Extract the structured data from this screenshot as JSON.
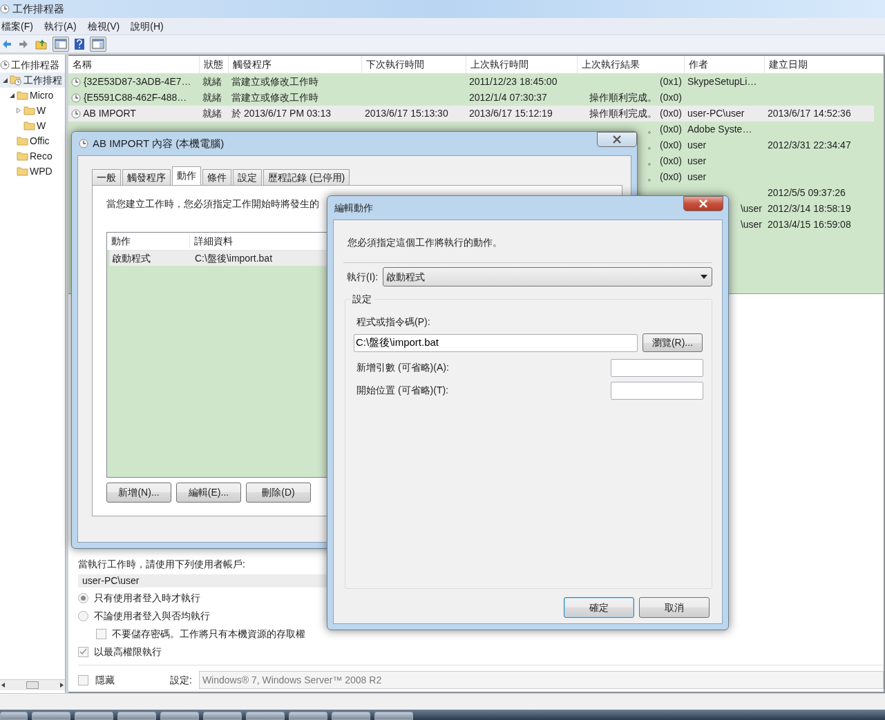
{
  "window": {
    "title": "工作排程器"
  },
  "menu": [
    "檔案(F)",
    "執行(A)",
    "檢視(V)",
    "說明(H)"
  ],
  "tree": [
    {
      "label": "工作排程器",
      "kind": "scheduler",
      "children": [
        {
          "label": "工作排程",
          "kind": "library",
          "expanded": true,
          "selected": true,
          "children": [
            {
              "label": "Micro",
              "kind": "folder",
              "expanded": true,
              "selected": false,
              "children": [
                {
                  "label": "W",
                  "kind": "folder",
                  "expanded": false,
                  "selected": false
                },
                {
                  "label": "W",
                  "kind": "folder",
                  "selected": false
                }
              ]
            },
            {
              "label": "Offic",
              "kind": "folder",
              "selected": false
            },
            {
              "label": "Reco",
              "kind": "folder",
              "selected": false
            },
            {
              "label": "WPD",
              "kind": "folder",
              "selected": false
            }
          ]
        }
      ],
      "selected": false
    }
  ],
  "table": {
    "columns": [
      "名稱",
      "狀態",
      "觸發程序",
      "下次執行時間",
      "上次執行時間",
      "上次執行結果",
      "作者",
      "建立日期"
    ],
    "rows": [
      {
        "selected": false,
        "icon": true,
        "name": "{32E53D87-3ADB-4E7…",
        "status": "就緒",
        "trigger": "當建立或修改工作時",
        "last_run": "2011/12/23 18:45:00",
        "result": "(0x1)",
        "author": "SkypeSetupLi…"
      },
      {
        "selected": false,
        "icon": true,
        "name": "{E5591C88-462F-488…",
        "status": "就緒",
        "trigger": "當建立或修改工作時",
        "last_run": "2012/1/4 07:30:37",
        "result": "操作順利完成。 (0x0)"
      },
      {
        "selected": true,
        "icon": true,
        "name": "AB IMPORT",
        "status": "就緒",
        "trigger": "於 2013/6/17 PM 03:13",
        "next_run": "2013/6/17 15:13:30",
        "last_run": "2013/6/17 15:12:19",
        "result": "操作順利完成。 (0x0)",
        "author": "user-PC\\user",
        "created": "2013/6/17 14:52:36"
      },
      {
        "selected": false,
        "result": "。 (0x0)",
        "author": "Adobe Syste…"
      },
      {
        "selected": false,
        "result": "。 (0x0)",
        "author": "user",
        "created": "2012/3/31 22:34:47"
      },
      {
        "selected": false,
        "result": "。 (0x0)",
        "author": "user"
      },
      {
        "selected": false,
        "result": "。 (0x0)",
        "author": "user"
      },
      {
        "selected": false,
        "created": "2012/5/5 09:37:26"
      },
      {
        "selected": false,
        "author": {
          "text": "\\user",
          "cut_left": true
        },
        "created": "2012/3/14 18:58:19"
      },
      {
        "selected": false,
        "author": {
          "text": "\\user",
          "cut_left": true
        },
        "created": "2013/4/15 16:59:08"
      }
    ]
  },
  "security": {
    "label": "當執行工作時，請使用下列使用者帳戶:",
    "account": "user-PC\\user",
    "options": [
      {
        "kind": "radio",
        "label": "只有使用者登入時才執行",
        "checked": true
      },
      {
        "kind": "radio",
        "label": "不論使用者登入與否均執行",
        "checked": false
      },
      {
        "kind": "checkbox",
        "label": "不要儲存密碼。工作將只有本機資源的存取權",
        "checked": false,
        "indent": true
      },
      {
        "kind": "checkbox",
        "label": "以最高權限執行",
        "checked": true
      }
    ],
    "hidden": {
      "label": "隱藏",
      "checked": false
    },
    "configure_label": "設定:",
    "configure_value": "Windows® 7, Windows Server™ 2008 R2"
  },
  "properties_dialog": {
    "title": "AB IMPORT 內容 (本機電腦)",
    "tabs": [
      {
        "label": "一般",
        "selected": false
      },
      {
        "label": "觸發程序",
        "selected": false
      },
      {
        "label": "動作",
        "selected": true
      },
      {
        "label": "條件",
        "selected": false
      },
      {
        "label": "設定",
        "selected": false
      },
      {
        "label": "歷程記錄 (已停用)",
        "selected": false
      }
    ],
    "description": "當您建立工作時，您必須指定工作開始時將發生的",
    "columns": [
      "動作",
      "詳細資料"
    ],
    "rows": [
      {
        "action": "啟動程式",
        "details": "C:\\盤後\\import.bat"
      }
    ],
    "buttons": [
      "新增(N)...",
      "編輯(E)...",
      "刪除(D)"
    ]
  },
  "edit_dialog": {
    "title": "編輯動作",
    "description": "您必須指定這個工作將執行的動作。",
    "action_label": "執行(I):",
    "action_value": "啟動程式",
    "group": "設定",
    "program_label": "程式或指令碼(P):",
    "program_value": "C:\\盤後\\import.bat",
    "browse": "瀏覽(R)...",
    "args_label": "新增引數 (可省略)(A):",
    "start_label": "開始位置 (可省略)(T):",
    "buttons": [
      {
        "label": "確定",
        "default": true
      },
      {
        "label": "取消",
        "default": false
      }
    ]
  }
}
